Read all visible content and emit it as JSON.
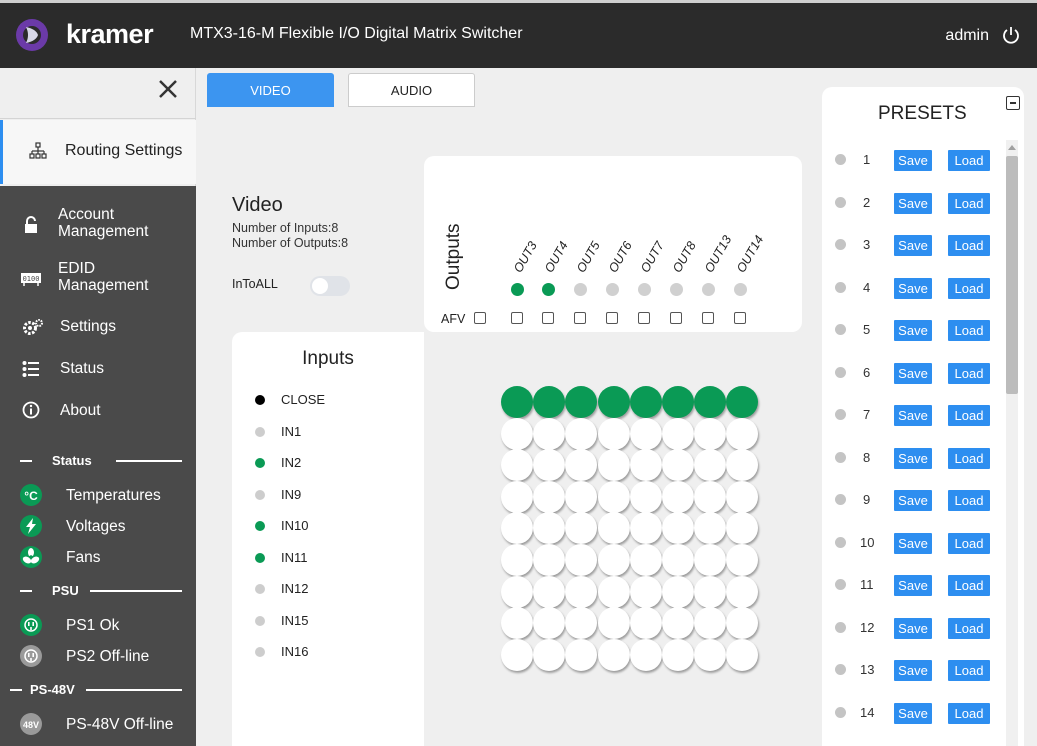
{
  "header": {
    "brand": "kramer",
    "product_title": "MTX3-16-M Flexible I/O Digital Matrix Switcher",
    "user": "admin"
  },
  "sidebar": {
    "active": "Routing Settings",
    "items": [
      "Account\nManagement",
      "EDID\nManagement",
      "Settings",
      "Status",
      "About"
    ],
    "sections": [
      {
        "title": "Status",
        "items": [
          {
            "label": "Temperatures",
            "icon": "thermometer-icon",
            "color": "#0a9a55"
          },
          {
            "label": "Voltages",
            "icon": "lightning-icon",
            "color": "#0a9a55"
          },
          {
            "label": "Fans",
            "icon": "fan-icon",
            "color": "#0a9a55"
          }
        ]
      },
      {
        "title": "PSU",
        "items": [
          {
            "label": "PS1 Ok",
            "icon": "plug-icon",
            "color": "#0a9a55"
          },
          {
            "label": "PS2 Off-line",
            "icon": "plug-icon",
            "color": "#9a9a9a"
          }
        ]
      },
      {
        "title": "PS-48V",
        "items": [
          {
            "label": "PS-48V Off-line",
            "icon": "48v-icon",
            "color": "#9a9a9a",
            "icon_text": "48V"
          }
        ]
      }
    ]
  },
  "tabs": [
    "VIDEO",
    "AUDIO"
  ],
  "video": {
    "title": "Video",
    "inputs_count": "Number of Inputs:8",
    "outputs_count": "Number of Outputs:8",
    "intoall": "InToALL"
  },
  "outputs": {
    "label": "Outputs",
    "afv": "AFV",
    "items": [
      {
        "name": "OUT3",
        "active": true
      },
      {
        "name": "OUT4",
        "active": true
      },
      {
        "name": "OUT5",
        "active": false
      },
      {
        "name": "OUT6",
        "active": false
      },
      {
        "name": "OUT7",
        "active": false
      },
      {
        "name": "OUT8",
        "active": false
      },
      {
        "name": "OUT13",
        "active": false
      },
      {
        "name": "OUT14",
        "active": false
      }
    ]
  },
  "inputs": {
    "title": "Inputs",
    "items": [
      {
        "name": "CLOSE",
        "state": "black"
      },
      {
        "name": "IN1",
        "state": "off"
      },
      {
        "name": "IN2",
        "state": "on"
      },
      {
        "name": "IN9",
        "state": "off"
      },
      {
        "name": "IN10",
        "state": "on"
      },
      {
        "name": "IN11",
        "state": "on"
      },
      {
        "name": "IN12",
        "state": "off"
      },
      {
        "name": "IN15",
        "state": "off"
      },
      {
        "name": "IN16",
        "state": "off"
      }
    ]
  },
  "matrix": {
    "selected_row": 0
  },
  "presets": {
    "title": "PRESETS",
    "save": "Save",
    "load": "Load",
    "numbers": [
      "1",
      "2",
      "3",
      "4",
      "5",
      "6",
      "7",
      "8",
      "9",
      "10",
      "11",
      "12",
      "13",
      "14"
    ]
  },
  "colors": {
    "accent": "#2d8ef0",
    "active": "#0a9a55",
    "inactive": "#c8c8c8"
  }
}
